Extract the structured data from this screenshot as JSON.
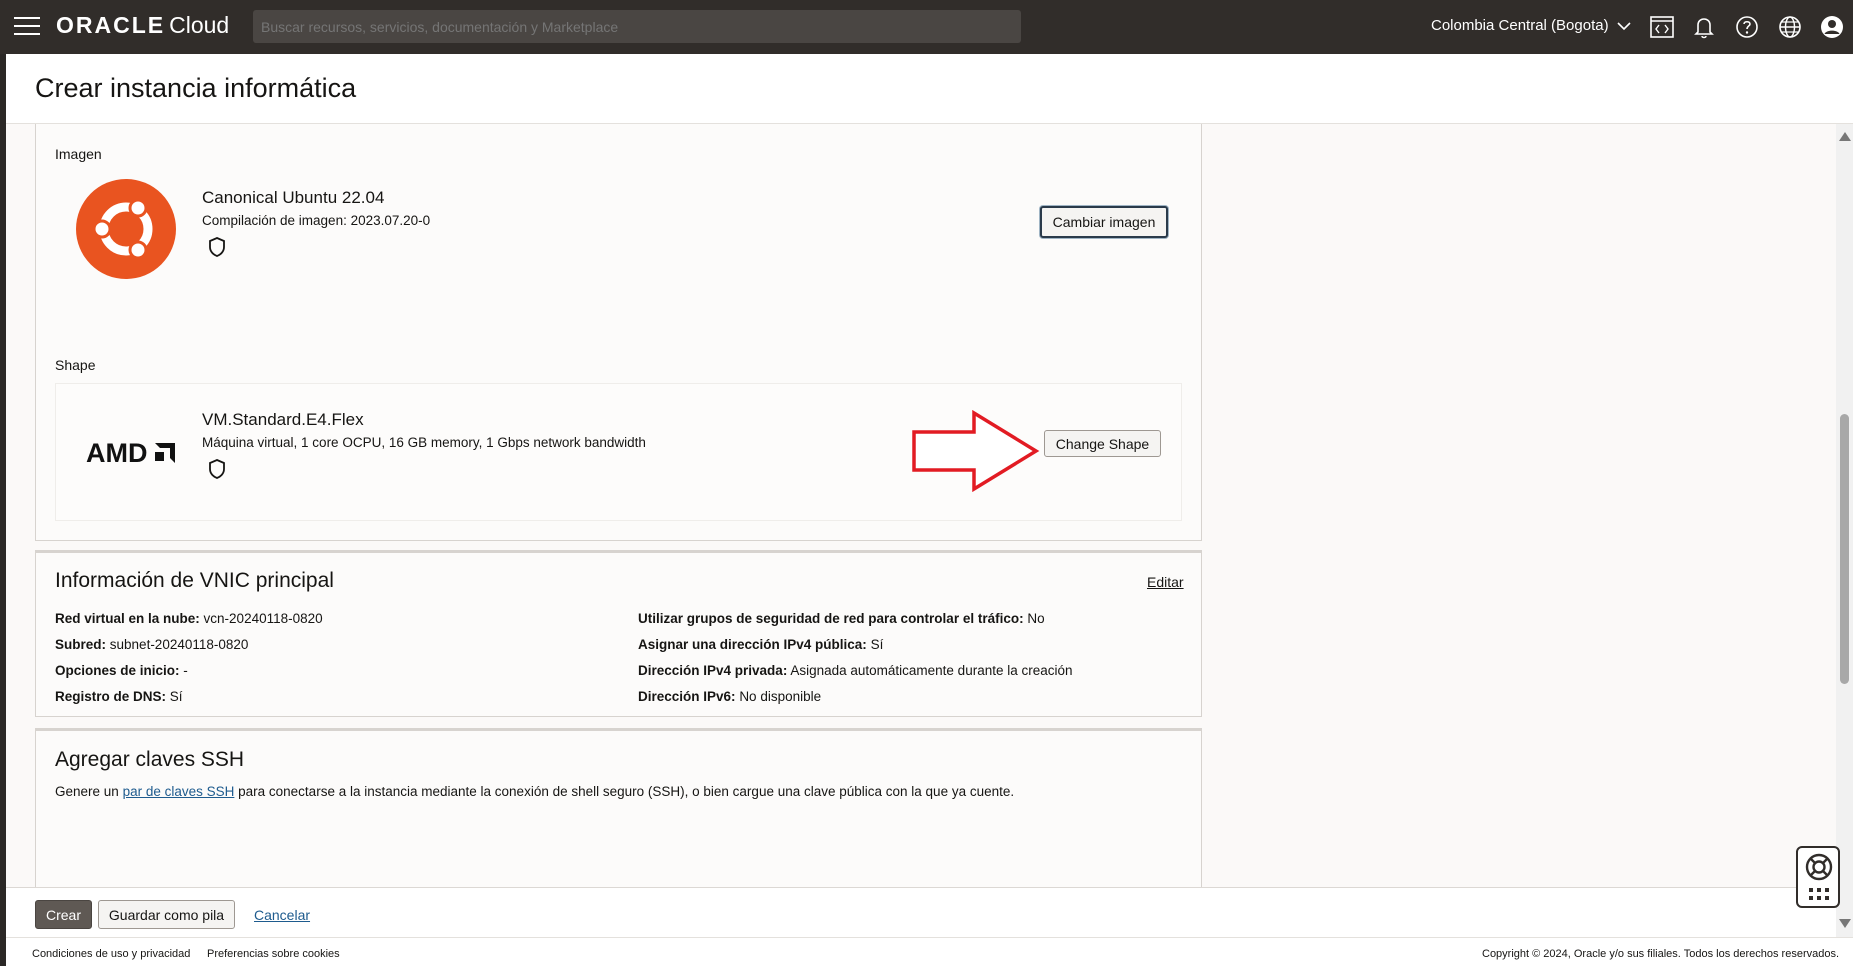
{
  "topbar": {
    "brand_main": "ORACLE",
    "brand_sub": "Cloud",
    "search_placeholder": "Buscar recursos, servicios, documentación y Marketplace",
    "region": "Colombia Central (Bogota)",
    "icons": [
      "menu-icon",
      "code-editor-icon",
      "bell-icon",
      "help-icon",
      "globe-icon",
      "profile-icon"
    ]
  },
  "page": {
    "title": "Crear instancia informática"
  },
  "image_section": {
    "label": "Imagen",
    "name": "Canonical Ubuntu 22.04",
    "build": "Compilación de imagen: 2023.07.20-0",
    "button": "Cambiar imagen",
    "logo_color": "#e95420"
  },
  "shape_section": {
    "label": "Shape",
    "vendor": "AMD",
    "name": "VM.Standard.E4.Flex",
    "desc": "Máquina virtual, 1 core OCPU, 16 GB memory, 1 Gbps network bandwidth",
    "button": "Change Shape",
    "arrow_color": "#e21b23"
  },
  "vnic": {
    "title": "Información de VNIC principal",
    "edit": "Editar",
    "left": [
      {
        "k": "Red virtual en la nube:",
        "v": "vcn-20240118-0820"
      },
      {
        "k": "Subred:",
        "v": "subnet-20240118-0820"
      },
      {
        "k": "Opciones de inicio:",
        "v": "-"
      },
      {
        "k": "Registro de DNS:",
        "v": "Sí"
      }
    ],
    "right": [
      {
        "k": "Utilizar grupos de seguridad de red para controlar el tráfico:",
        "v": "No"
      },
      {
        "k": "Asignar una dirección IPv4 pública:",
        "v": "Sí"
      },
      {
        "k": "Dirección IPv4 privada:",
        "v": "Asignada automáticamente durante la creación"
      },
      {
        "k": "Dirección IPv6:",
        "v": "No disponible"
      }
    ]
  },
  "ssh": {
    "title": "Agregar claves SSH",
    "text_before": "Genere un",
    "link": "par de claves SSH",
    "text_after": "para conectarse a la instancia mediante la conexión de shell seguro (SSH), o bien cargue una clave pública con la que ya cuente."
  },
  "actions": {
    "create": "Crear",
    "save_stack": "Guardar como pila",
    "cancel": "Cancelar"
  },
  "footer": {
    "terms": "Condiciones de uso y privacidad",
    "cookies": "Preferencias sobre cookies",
    "copyright": "Copyright © 2024, Oracle y/o sus filiales. Todos los derechos reservados."
  }
}
